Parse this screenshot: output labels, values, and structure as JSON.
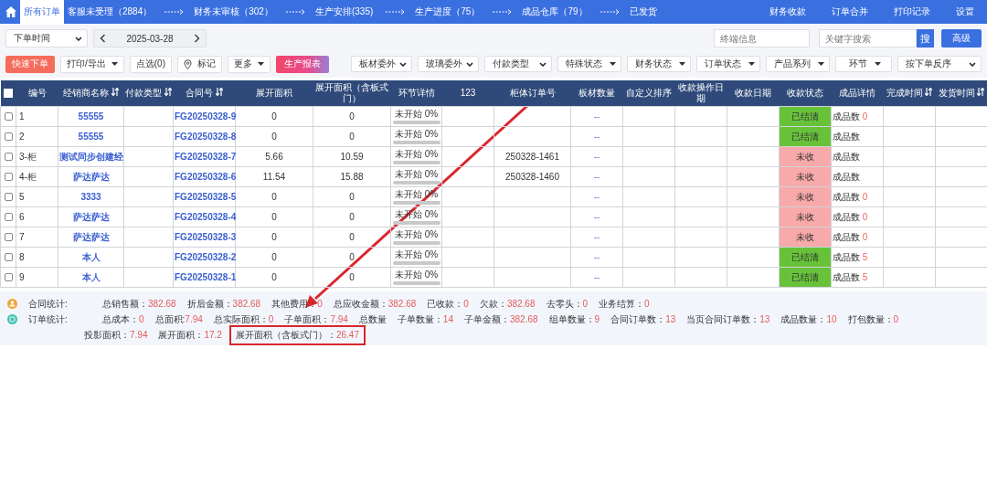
{
  "nav": {
    "items": [
      {
        "label": "所有订单",
        "selected": true
      },
      {
        "label": "客服未受理（2884）",
        "selected": false
      },
      {
        "label": "财务未审核（302）",
        "selected": false
      },
      {
        "label": "生产安排(335)",
        "selected": false
      },
      {
        "label": "生产进度（75）",
        "selected": false
      },
      {
        "label": "成品仓库（79）",
        "selected": false
      },
      {
        "label": "已发货",
        "selected": false
      }
    ],
    "links": [
      "财务收款",
      "订单合并",
      "打印记录",
      "设置"
    ]
  },
  "toolbar": {
    "date_type": "下单时间",
    "date": "2025-03-28",
    "terminal_field": {
      "placeholder": "终端信息"
    },
    "search_field": {
      "placeholder": "关键字搜索"
    },
    "search_button": "搜",
    "advanced_button": "高级"
  },
  "actions": [
    {
      "label": "快速下单",
      "kind": "primary"
    },
    {
      "label": "打印/导出",
      "kind": "dropdown"
    },
    {
      "label": "点选(0)",
      "kind": "plain"
    },
    {
      "label": "标记",
      "kind": "pin"
    },
    {
      "label": "更多",
      "kind": "dropdown"
    },
    {
      "label": "生产报表",
      "kind": "gradient"
    }
  ],
  "filters": [
    {
      "label": "板材委外",
      "kind": "select"
    },
    {
      "label": "玻璃委外",
      "kind": "select"
    },
    {
      "label": "付款类型",
      "kind": "select"
    },
    {
      "label": "特殊状态",
      "kind": "dropdown"
    },
    {
      "label": "财务状态",
      "kind": "dropdown"
    },
    {
      "label": "订单状态",
      "kind": "dropdown"
    },
    {
      "label": "产品系列",
      "kind": "dropdown"
    },
    {
      "label": "环节",
      "kind": "dropdown"
    },
    {
      "label": "按下单反序",
      "kind": "select"
    }
  ],
  "table": {
    "all_checked": false,
    "columns": [
      {
        "label": "编号",
        "sortable": false
      },
      {
        "label": "经销商名称",
        "sortable": true
      },
      {
        "label": "付款类型",
        "sortable": true
      },
      {
        "label": "合同号",
        "sortable": true
      },
      {
        "label": "展开面积",
        "sortable": false
      },
      {
        "label": "展开面积（含板式门）",
        "sortable": false
      },
      {
        "label": "环节详情",
        "sortable": false
      },
      {
        "label": "123",
        "sortable": false
      },
      {
        "label": "柜体订单号",
        "sortable": false
      },
      {
        "label": "板材数量",
        "sortable": false
      },
      {
        "label": "自定义排序",
        "sortable": false
      },
      {
        "label": "收款操作日期",
        "sortable": false
      },
      {
        "label": "收款日期",
        "sortable": false
      },
      {
        "label": "收款状态",
        "sortable": false
      },
      {
        "label": "成品详情",
        "sortable": false
      },
      {
        "label": "完成时间",
        "sortable": true
      },
      {
        "label": "发货时间",
        "sortable": true
      }
    ],
    "rows": [
      {
        "checked": false,
        "no": "1",
        "dealer": "55555",
        "contract": "FG20250328-9",
        "area": "0",
        "area_door": "0",
        "progress": {
          "text": "未开始 0%",
          "level": 0
        },
        "panels": "--",
        "payment": {
          "label": "已结清",
          "kind": "paid"
        },
        "product": {
          "label": "成品数",
          "count": "0"
        }
      },
      {
        "checked": false,
        "no": "2",
        "dealer": "55555",
        "contract": "FG20250328-8",
        "area": "0",
        "area_door": "0",
        "progress": {
          "text": "未开始 0%",
          "level": 0
        },
        "panels": "--",
        "payment": {
          "label": "已结清",
          "kind": "paid"
        },
        "product": {
          "label": "成品数"
        }
      },
      {
        "checked": false,
        "no": "3-柜",
        "dealer": "测试同步创建经",
        "contract": "FG20250328-7",
        "area": "5.66",
        "area_door": "10.59",
        "progress": {
          "text": "未开始 0%",
          "level": 0
        },
        "cabinet_order": "250328-1461",
        "panels": "--",
        "payment": {
          "label": "未收",
          "kind": "unpaid"
        },
        "product": {
          "label": "成品数"
        }
      },
      {
        "checked": false,
        "no": "4-柜",
        "dealer": "萨达萨达",
        "contract": "FG20250328-6",
        "area": "11.54",
        "area_door": "15.88",
        "progress": {
          "text": "未开始 0%",
          "level": 0
        },
        "cabinet_order": "250328-1460",
        "panels": "--",
        "payment": {
          "label": "未收",
          "kind": "unpaid"
        },
        "product": {
          "label": "成品数"
        }
      },
      {
        "checked": false,
        "no": "5",
        "dealer": "3333",
        "contract": "FG20250328-5",
        "area": "0",
        "area_door": "0",
        "progress": {
          "text": "未开始 0%",
          "level": 0
        },
        "panels": "--",
        "payment": {
          "label": "未收",
          "kind": "unpaid"
        },
        "product": {
          "label": "成品数",
          "count": "0"
        }
      },
      {
        "checked": false,
        "no": "6",
        "dealer": "萨达萨达",
        "contract": "FG20250328-4",
        "area": "0",
        "area_door": "0",
        "progress": {
          "text": "未开始 0%",
          "level": 0
        },
        "panels": "--",
        "payment": {
          "label": "未收",
          "kind": "unpaid"
        },
        "product": {
          "label": "成品数",
          "count": "0"
        }
      },
      {
        "checked": false,
        "no": "7",
        "dealer": "萨达萨达",
        "contract": "FG20250328-3",
        "area": "0",
        "area_door": "0",
        "progress": {
          "text": "未开始 0%",
          "level": 0
        },
        "panels": "--",
        "payment": {
          "label": "未收",
          "kind": "unpaid"
        },
        "product": {
          "label": "成品数",
          "count": "0"
        }
      },
      {
        "checked": false,
        "no": "8",
        "dealer": "本人",
        "contract": "FG20250328-2",
        "area": "0",
        "area_door": "0",
        "progress": {
          "text": "未开始 0%",
          "level": 0
        },
        "panels": "--",
        "payment": {
          "label": "已结清",
          "kind": "paid"
        },
        "product": {
          "label": "成品数",
          "count": "5"
        }
      },
      {
        "checked": false,
        "no": "9",
        "dealer": "本人",
        "contract": "FG20250328-1",
        "area": "0",
        "area_door": "0",
        "progress": {
          "text": "未开始 0%",
          "level": 0
        },
        "panels": "--",
        "payment": {
          "label": "已结清",
          "kind": "paid"
        },
        "product": {
          "label": "成品数",
          "count": "5"
        }
      }
    ]
  },
  "stats": [
    {
      "title": "合同统计:",
      "kind": "contract",
      "lines": [
        [
          {
            "label": "总销售额：",
            "value": "382.68"
          },
          {
            "label": "折后金额：",
            "value": "382.68"
          },
          {
            "label": "其他费用：",
            "value": "0"
          },
          {
            "label": "总应收金额：",
            "value": "382.68"
          },
          {
            "label": "已收款：",
            "value": "0"
          },
          {
            "label": "欠款：",
            "value": "382.68"
          },
          {
            "label": "去零头：",
            "value": "0"
          },
          {
            "label": "业务结算：",
            "value": "0"
          }
        ]
      ]
    },
    {
      "title": "订单统计:",
      "kind": "order",
      "lines": [
        [
          {
            "label": "总成本：",
            "value": "0"
          },
          {
            "label": "总面积:",
            "value": "7.94"
          },
          {
            "label": "总实际面积：",
            "value": "0"
          },
          {
            "label": "子单面积：",
            "value": "7.94"
          },
          {
            "label": "总数量"
          },
          {
            "label": "子单数量：",
            "value": "14"
          },
          {
            "label": "子单金额：",
            "value": "382.68"
          },
          {
            "label": "组单数量：",
            "value": "9"
          },
          {
            "label": "合同订单数：",
            "value": "13"
          },
          {
            "label": "当页合同订单数：",
            "value": "13"
          },
          {
            "label": "成品数量：",
            "value": "10"
          },
          {
            "label": "打包数量：",
            "value": "0"
          }
        ],
        [
          {
            "label": "投影面积：",
            "value": "7.94",
            "highlighted": false
          },
          {
            "label": "展开面积：",
            "value": "17.2",
            "highlighted": false
          },
          {
            "label": "展开面积（含板式门）：",
            "value": "26.47",
            "highlighted": true
          }
        ]
      ]
    }
  ]
}
